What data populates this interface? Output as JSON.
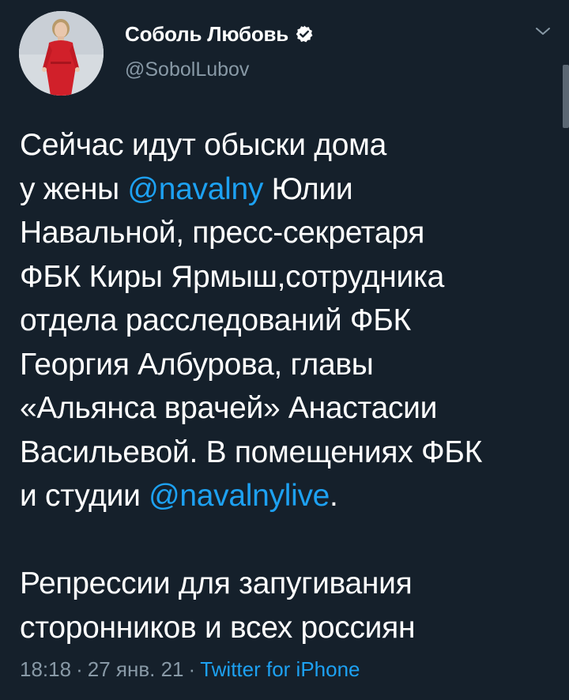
{
  "author": {
    "display_name": "Соболь Любовь",
    "handle": "@SobolLubov",
    "verified_icon": "verified-badge-icon",
    "avatar_icon": "profile-avatar"
  },
  "menu_icon": "chevron-down-icon",
  "tweet": {
    "p1_l1": "Сейчас идут обыски дома",
    "p1_l2_before": "у жены ",
    "p1_l2_mention": "@navalny",
    "p1_l2_after": " Юлии",
    "p1_l3": "Навальной, пресс-секретаря",
    "p1_l4": "ФБК Киры Ярмыш,сотрудника",
    "p1_l5": "отдела расследований ФБК",
    "p1_l6": "Георгия Албурова, главы",
    "p1_l7": "«Альянса врачей» Анастасии",
    "p1_l8": "Васильевой. В помещениях ФБК",
    "p1_l9_before": "и студии ",
    "p1_l9_mention": "@navalnylive",
    "p1_l9_after": ".",
    "p2_l1": "Репрессии для запугивания",
    "p2_l2": "сторонников и всех россиян"
  },
  "meta": {
    "time": "18:18",
    "separator": "·",
    "date": "27 янв. 21",
    "source": "Twitter for iPhone"
  },
  "colors": {
    "background": "#15202b",
    "text": "#ffffff",
    "secondary": "#8899a6",
    "link": "#1da1f2"
  }
}
